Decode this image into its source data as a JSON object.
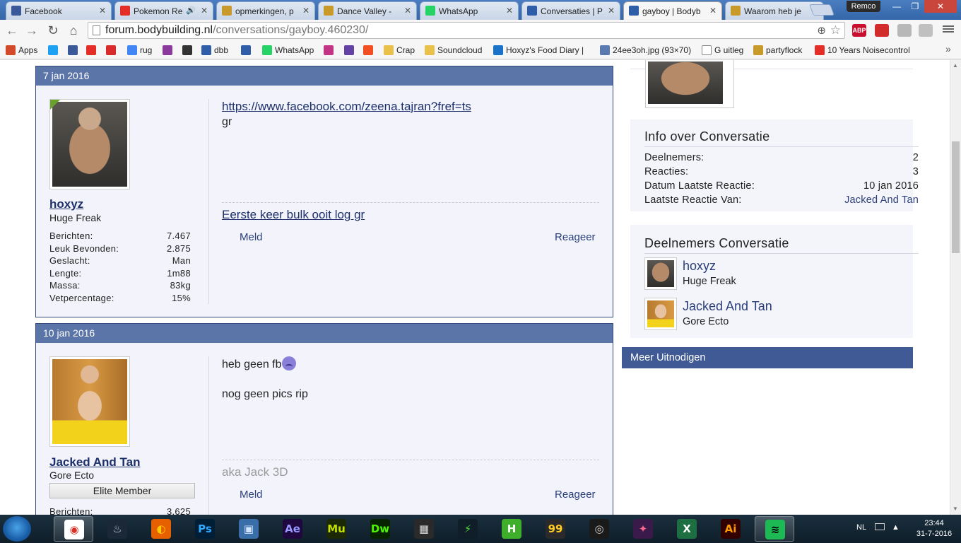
{
  "browser": {
    "tabs": [
      {
        "title": "Facebook",
        "color": "#3b5998"
      },
      {
        "title": "Pokemon Re",
        "color": "#e52d27",
        "audio": "🔊"
      },
      {
        "title": "opmerkingen, p",
        "color": "#c89a2a"
      },
      {
        "title": "Dance Valley - ",
        "color": "#c89a2a"
      },
      {
        "title": "WhatsApp",
        "color": "#25d366"
      },
      {
        "title": "Conversaties | P",
        "color": "#2f5ea8"
      },
      {
        "title": "gayboy | Bodyb",
        "color": "#2f5ea8"
      },
      {
        "title": "Waarom heb je",
        "color": "#c89a2a"
      }
    ],
    "tab_close_glyph": "✕",
    "profile_name": "Remco",
    "window_controls": {
      "minimize": "—",
      "maximize": "❐",
      "close": "✕"
    },
    "nav": {
      "back": "←",
      "forward": "→",
      "reload": "↻",
      "home": "⌂"
    },
    "url": {
      "host": "forum.bodybuilding.nl",
      "path": "/conversations/gayboy.460230/"
    },
    "zoom_glyph": "⊕",
    "star_glyph": "☆",
    "extensions": [
      {
        "label": "ABP",
        "color": "#c8102e"
      },
      {
        "label": "",
        "color": "#d12b2b"
      },
      {
        "label": "",
        "color": "#b8b8b8"
      },
      {
        "label": "",
        "color": "#c0c0c0"
      },
      {
        "label": "",
        "color": "#2b3a8a"
      }
    ],
    "bookmarks": [
      {
        "label": "Apps",
        "color": "#d34a2a"
      },
      {
        "label": "",
        "color": "#1da1f2"
      },
      {
        "label": "",
        "color": "#3b5998"
      },
      {
        "label": "",
        "color": "#e52d27"
      },
      {
        "label": "",
        "color": "#d92b2b"
      },
      {
        "label": "rug",
        "color": "#4285f4"
      },
      {
        "label": "",
        "color": "#8a3a9a"
      },
      {
        "label": "",
        "color": "#333333"
      },
      {
        "label": "dbb",
        "color": "#2f5ea8"
      },
      {
        "label": "",
        "color": "#2f5ea8"
      },
      {
        "label": "WhatsApp",
        "color": "#25d366"
      },
      {
        "label": "",
        "color": "#c13584"
      },
      {
        "label": "",
        "color": "#6441a5"
      },
      {
        "label": "",
        "color": "#f25022"
      },
      {
        "label": "Crap",
        "color": "#e8c04a"
      },
      {
        "label": "Soundcloud",
        "color": "#e8c04a"
      },
      {
        "label": "Hoxyz's Food Diary | ",
        "color": "#1a73c8"
      },
      {
        "label": "24ee3oh.jpg (93×70)",
        "color": "#5a7ab0"
      },
      {
        "label": "G uitleg",
        "color": "#ffffff"
      },
      {
        "label": "partyflock",
        "color": "#c89a2a"
      },
      {
        "label": "10 Years Noisecontrol",
        "color": "#e52d27"
      }
    ],
    "more_glyph": "»"
  },
  "posts": [
    {
      "date": "7 jan 2016",
      "username": "hoxyz",
      "user_title": "Huge Freak",
      "stats": [
        {
          "label": "Berichten:",
          "value": "7.467"
        },
        {
          "label": "Leuk Bevonden:",
          "value": "2.875"
        },
        {
          "label": "Geslacht:",
          "value": "Man"
        },
        {
          "label": "Lengte:",
          "value": "1m88"
        },
        {
          "label": "Massa:",
          "value": "83kg"
        },
        {
          "label": "Vetpercentage:",
          "value": "15%"
        }
      ],
      "message_link": "https://www.facebook.com/zeena.tajran?fref=ts",
      "message_text": "gr",
      "signature": "Eerste keer bulk ooit log gr",
      "report_label": "Meld",
      "reply_label": "Reageer"
    },
    {
      "date": "10 jan 2016",
      "username": "Jacked And Tan",
      "user_title": "Gore Ecto",
      "badge": "Elite Member",
      "stats": [
        {
          "label": "Berichten:",
          "value": "3.625"
        }
      ],
      "message_line1": "heb geen fb",
      "message_line2": "nog geen pics rip",
      "signature": "aka Jack 3D",
      "report_label": "Meld",
      "reply_label": "Reageer"
    }
  ],
  "sidebar": {
    "info": {
      "title": "Info over Conversatie",
      "rows": [
        {
          "label": "Deelnemers:",
          "value": "2"
        },
        {
          "label": "Reacties:",
          "value": "3"
        },
        {
          "label": "Datum Laatste Reactie:",
          "value": "10 jan 2016"
        },
        {
          "label": "Laatste Reactie Van:",
          "value": "Jacked And Tan"
        }
      ]
    },
    "participants": {
      "title": "Deelnemers Conversatie",
      "members": [
        {
          "name": "hoxyz",
          "title": "Huge Freak"
        },
        {
          "name": "Jacked And Tan",
          "title": "Gore Ecto"
        }
      ]
    },
    "invite_label": "Meer Uitnodigen"
  },
  "taskbar": {
    "apps": [
      {
        "name": "chrome",
        "glyph": "◉",
        "bg": "#ffffff",
        "fg": "#d93025",
        "active": true
      },
      {
        "name": "steam",
        "glyph": "♨",
        "bg": "#1b2838",
        "fg": "#c7d5e0"
      },
      {
        "name": "firefox",
        "glyph": "◐",
        "bg": "#e66000",
        "fg": "#ffcb00"
      },
      {
        "name": "photoshop",
        "glyph": "Ps",
        "bg": "#001e36",
        "fg": "#31a8ff"
      },
      {
        "name": "computer",
        "glyph": "▣",
        "bg": "#3a6ea8",
        "fg": "#cfe3ff"
      },
      {
        "name": "after-effects",
        "glyph": "Ae",
        "bg": "#1f0740",
        "fg": "#9999ff"
      },
      {
        "name": "muse",
        "glyph": "Mu",
        "bg": "#1b2a05",
        "fg": "#c4e000"
      },
      {
        "name": "dreamweaver",
        "glyph": "Dw",
        "bg": "#072401",
        "fg": "#4cf500"
      },
      {
        "name": "movie-maker",
        "glyph": "▦",
        "bg": "#2a2a2a",
        "fg": "#dddddd"
      },
      {
        "name": "razer",
        "glyph": "⚡",
        "bg": "#0f1e29",
        "fg": "#44d62c"
      },
      {
        "name": "hotspot",
        "glyph": "H",
        "bg": "#3fae2a",
        "fg": "#ffffff"
      },
      {
        "name": "osu",
        "glyph": "99",
        "bg": "#2a2a2a",
        "fg": "#ffcc22"
      },
      {
        "name": "ccleaner",
        "glyph": "◎",
        "bg": "#1a1a1a",
        "fg": "#cccccc"
      },
      {
        "name": "game",
        "glyph": "✦",
        "bg": "#3a1a4a",
        "fg": "#ff6688"
      },
      {
        "name": "excel",
        "glyph": "X",
        "bg": "#1d6f42",
        "fg": "#ffffff"
      },
      {
        "name": "illustrator",
        "glyph": "Ai",
        "bg": "#330000",
        "fg": "#ff9a00"
      },
      {
        "name": "spotify",
        "glyph": "≋",
        "bg": "#1db954",
        "fg": "#000000",
        "active": true
      }
    ],
    "language": "NL",
    "time": "23:44",
    "date": "31-7-2016"
  }
}
